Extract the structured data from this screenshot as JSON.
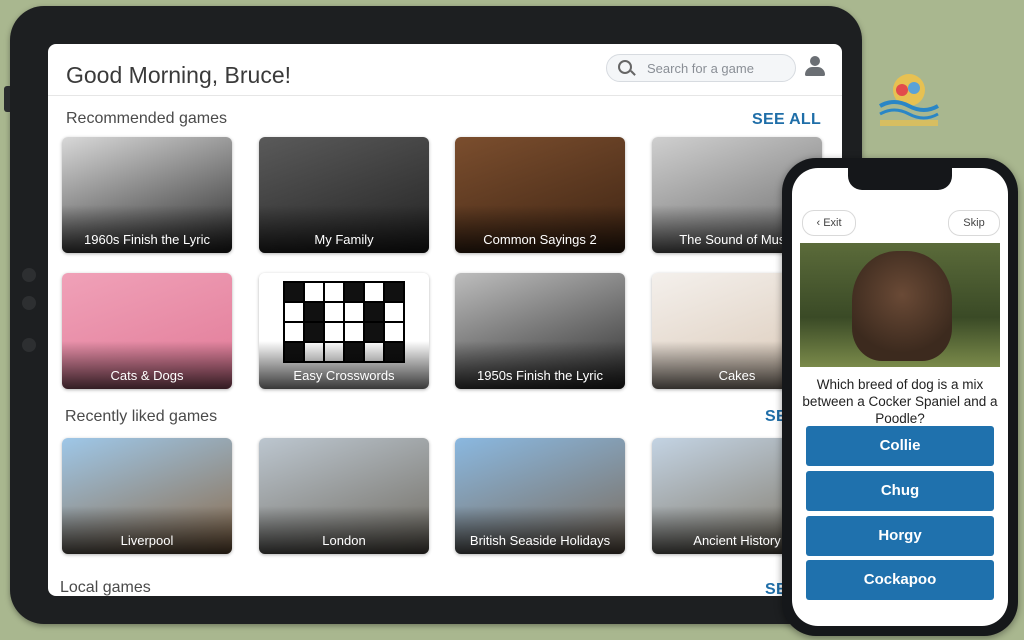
{
  "tablet": {
    "greeting": "Good Morning, Bruce!",
    "search_placeholder": "Search for a game",
    "sections": [
      {
        "title": "Recommended games",
        "see_all": "SEE ALL"
      },
      {
        "title": "Recently liked games",
        "see_all": "SEE"
      },
      {
        "title": "Local games",
        "see_all": "SEE"
      }
    ],
    "recommended": [
      {
        "label": "1960s Finish the Lyric",
        "colors": [
          "#d8d8d8",
          "#2a2a2a"
        ]
      },
      {
        "label": "My Family",
        "colors": [
          "#5a5a5a",
          "#222"
        ]
      },
      {
        "label": "Common Sayings 2",
        "colors": [
          "#7b4e2e",
          "#3e2413"
        ]
      },
      {
        "label": "The Sound of Music",
        "colors": [
          "#cfcfcf",
          "#6a6a6a"
        ]
      },
      {
        "label": "Cats & Dogs",
        "colors": [
          "#f0a1b8",
          "#e17a97"
        ]
      },
      {
        "label": "Easy Crosswords",
        "colors": [
          "#ffffff",
          "#ffffff"
        ]
      },
      {
        "label": "1950s Finish the Lyric",
        "colors": [
          "#bdbdbd",
          "#2f2f2f"
        ]
      },
      {
        "label": "Cakes",
        "colors": [
          "#f4f0ec",
          "#d9c7b5"
        ]
      }
    ],
    "recently_liked": [
      {
        "label": "Liverpool",
        "colors": [
          "#9ec7e8",
          "#8a6a4a"
        ]
      },
      {
        "label": "London",
        "colors": [
          "#bcc6cf",
          "#6f6a60"
        ]
      },
      {
        "label": "British Seaside Holidays",
        "colors": [
          "#8ab8e0",
          "#7a6a5a"
        ]
      },
      {
        "label": "Ancient History",
        "colors": [
          "#c3d3e3",
          "#7d7463"
        ]
      }
    ]
  },
  "phone": {
    "exit_label": "Exit",
    "skip_label": "Skip",
    "question": "Which breed of dog is a mix between a Cocker Spaniel and a Poodle?",
    "answers": [
      "Collie",
      "Chug",
      "Horgy",
      "Cockapoo"
    ]
  },
  "colors": {
    "background": "#a9b78f",
    "accent": "#1f71ad",
    "see_all": "#1f6ea8"
  }
}
